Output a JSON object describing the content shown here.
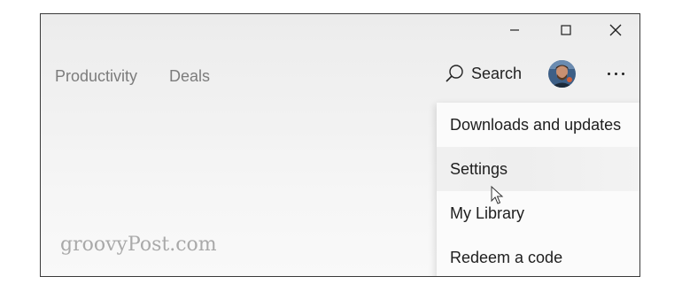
{
  "window": {
    "controls": {
      "minimize_icon": "minimize-icon",
      "maximize_icon": "maximize-icon",
      "close_icon": "close-icon"
    }
  },
  "nav": {
    "items": [
      {
        "label": "Productivity"
      },
      {
        "label": "Deals"
      }
    ]
  },
  "header": {
    "search_label": "Search",
    "search_icon": "search-icon",
    "avatar_icon": "user-avatar",
    "more_icon": "more-options-icon"
  },
  "menu": {
    "items": [
      {
        "label": "Downloads and updates"
      },
      {
        "label": "Settings",
        "hovered": true
      },
      {
        "label": "My Library"
      },
      {
        "label": "Redeem a code"
      }
    ]
  },
  "watermark": {
    "text": "groovyPost.com"
  },
  "colors": {
    "accent_text": "#1e1e1e",
    "nav_text": "#7c7c7c",
    "menu_bg": "#fbfbfb",
    "watermark": "#a9a9a9"
  }
}
